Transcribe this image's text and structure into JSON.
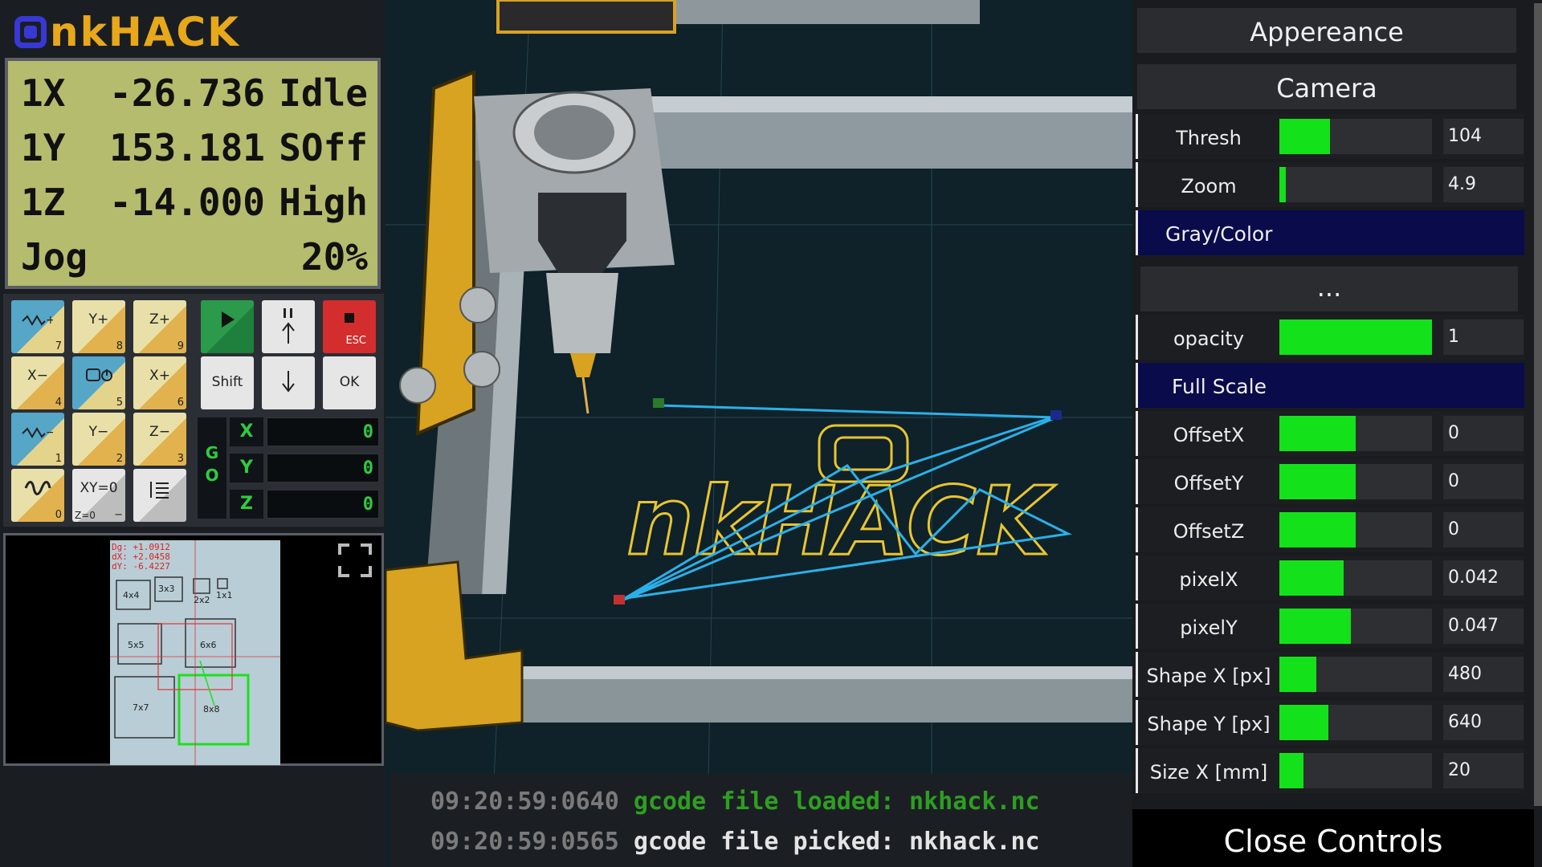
{
  "app": {
    "logo_text": "nkHACK"
  },
  "lcd": {
    "rows": [
      {
        "a": "1X",
        "b": "-26.736",
        "c": "Idle"
      },
      {
        "a": "1Y",
        "b": "153.181",
        "c": "SOff"
      },
      {
        "a": "1Z",
        "b": "-14.000",
        "c": "High"
      }
    ],
    "jog_label": "Jog",
    "jog_value": "20%"
  },
  "keypad": {
    "keys": [
      {
        "label": "",
        "num": "7"
      },
      {
        "label": "Y+",
        "num": "8"
      },
      {
        "label": "Z+",
        "num": "9"
      },
      {
        "label": "X−",
        "num": "4"
      },
      {
        "label": "",
        "num": "5"
      },
      {
        "label": "X+",
        "num": "6"
      },
      {
        "label": "",
        "num": "1"
      },
      {
        "label": "Y−",
        "num": "2"
      },
      {
        "label": "Z−",
        "num": "3"
      },
      {
        "label": "",
        "num": "0"
      },
      {
        "label": "XY=0",
        "num": "−",
        "subl": "Z=0"
      },
      {
        "label": "",
        "num": ""
      }
    ],
    "shift_label": "Shift",
    "ok_label": "OK",
    "esc_label": "ESC"
  },
  "goto": {
    "go_label_1": "G",
    "go_label_2": "O",
    "axes": [
      {
        "axis": "X",
        "value": "0"
      },
      {
        "axis": "Y",
        "value": "0"
      },
      {
        "axis": "Z",
        "value": "0"
      }
    ]
  },
  "camera_preview": {
    "dg": "Dg: +1.0912",
    "dx": "dX: +2.0458",
    "dy": "dY: -6.4227",
    "boxes": [
      "4x4",
      "3x3",
      "2x2",
      "1x1",
      "5x5",
      "6x6",
      "7x7",
      "8x8"
    ]
  },
  "viewport": {
    "logo_text": "nkHACK"
  },
  "console": {
    "lines": [
      {
        "ts": "09:20:59:0640",
        "msg": "gcode file loaded: nkhack.nc"
      },
      {
        "ts": "09:20:59:0565",
        "msg": "gcode file picked: nkhack.nc"
      }
    ]
  },
  "panel": {
    "appearance": "Appereance",
    "camera": "Camera",
    "gray_color": "Gray/Color",
    "ellipsis": "...",
    "full_scale": "Full Scale",
    "close": "Close Controls",
    "controls": {
      "thresh": {
        "name": "Thresh",
        "value": "104",
        "level": 0.33
      },
      "zoom": {
        "name": "Zoom",
        "value": "4.9",
        "level": 0.04
      },
      "opacity": {
        "name": "opacity",
        "value": "1",
        "level": 1.0
      },
      "offsetx": {
        "name": "OffsetX",
        "value": "0",
        "level": 0.5
      },
      "offsety": {
        "name": "OffsetY",
        "value": "0",
        "level": 0.5
      },
      "offsetz": {
        "name": "OffsetZ",
        "value": "0",
        "level": 0.5
      },
      "pixelx": {
        "name": "pixelX",
        "value": "0.042",
        "level": 0.42
      },
      "pixely": {
        "name": "pixelY",
        "value": "0.047",
        "level": 0.47
      },
      "shapex": {
        "name": "Shape X [px]",
        "value": "480",
        "level": 0.24
      },
      "shapey": {
        "name": "Shape Y [px]",
        "value": "640",
        "level": 0.32
      },
      "sizex": {
        "name": "Size X [mm]",
        "value": "20",
        "level": 0.16
      }
    }
  },
  "colors": {
    "accent_green": "#13e21a",
    "brand_gold": "#e8a81a",
    "brand_blue": "#3838d6",
    "toolpath": "#2ab0e8",
    "group_header": "#090b4a"
  }
}
